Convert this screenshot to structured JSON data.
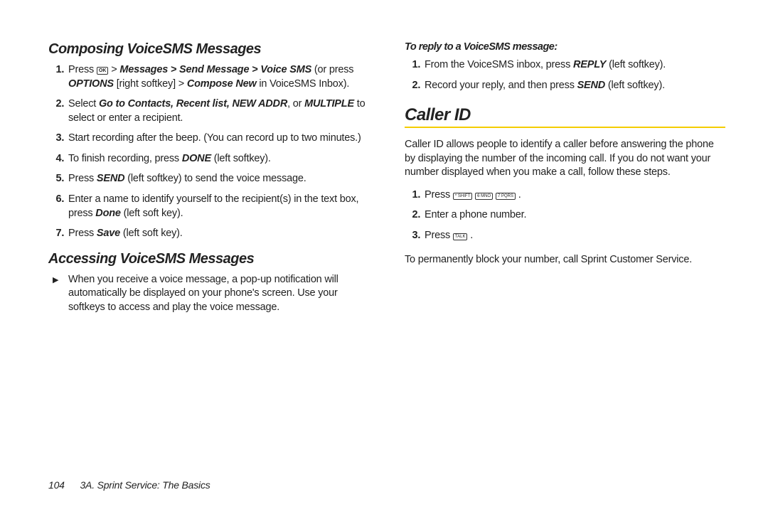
{
  "left": {
    "h1": "Composing VoiceSMS Messages",
    "steps": {
      "s1a": "Press ",
      "s1_key": "MENU OK",
      "s1b": " > ",
      "s1_path": "Messages > Send Message > Voice SMS",
      "s1c": " (or press ",
      "s1_opt": "OPTIONS",
      "s1d": " [right softkey] > ",
      "s1_cn": "Compose New",
      "s1e": " in VoiceSMS Inbox).",
      "s2a": "Select ",
      "s2_b": "Go to Contacts, Recent list, NEW ADDR",
      "s2b": ", or ",
      "s2_m": "MULTIPLE",
      "s2c": " to select or enter a recipient.",
      "s3": "Start recording after the beep. (You can record up to two minutes.)",
      "s4a": "To finish recording, press ",
      "s4_b": "DONE",
      "s4b": " (left softkey).",
      "s5a": "Press ",
      "s5_b": "SEND",
      "s5b": " (left softkey) to send the voice message.",
      "s6a": "Enter a name to identify yourself to the recipient(s) in the text box, press ",
      "s6_b": "Done",
      "s6b": " (left soft key).",
      "s7a": "Press ",
      "s7_b": "Save",
      "s7b": " (left soft key)."
    },
    "h2": "Accessing VoiceSMS Messages",
    "bullet1": "When you receive a voice message, a pop-up notification will automatically be displayed on your phone's screen. Use your softkeys to access and play the voice message."
  },
  "right": {
    "h_reply": "To reply to a VoiceSMS message:",
    "r1a": "From the VoiceSMS inbox, press ",
    "r1_b": "REPLY",
    "r1b": " (left softkey).",
    "r2a": "Record your reply, and then press ",
    "r2_b": "SEND",
    "r2b": " (left softkey).",
    "h_caller": "Caller ID",
    "caller_para": "Caller ID allows people to identify a caller before answering the phone by displaying the number of the incoming call. If you do not want your number displayed when you make a call, follow these steps.",
    "c1a": "Press ",
    "key_star": "* SHIFT",
    "key_6": "6 MNO",
    "key_7": "7 PQRS",
    "c1b": " .",
    "c2": "Enter a phone number.",
    "c3a": "Press ",
    "key_talk": "TALK",
    "c3b": " .",
    "perm": "To permanently block your number, call Sprint Customer Service."
  },
  "footer": {
    "page": "104",
    "title": "3A. Sprint Service: The Basics"
  }
}
